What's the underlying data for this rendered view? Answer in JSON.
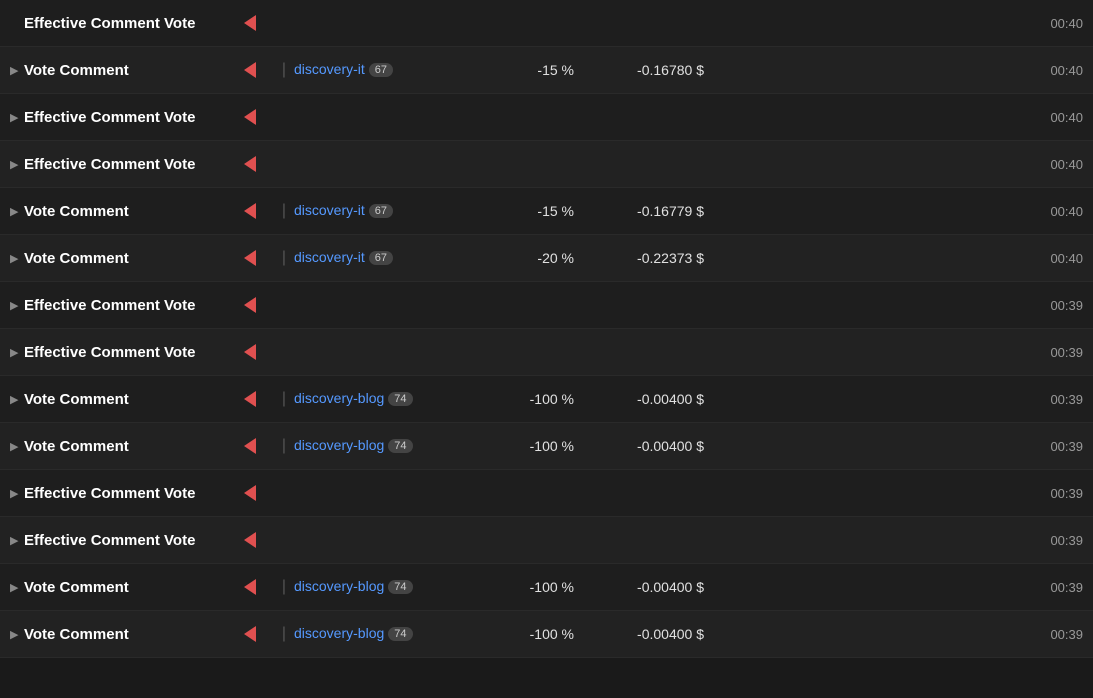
{
  "rows": [
    {
      "type": "effective",
      "title": "Effective Comment Vote",
      "hasExpand": false,
      "time": "00:40"
    },
    {
      "type": "vote",
      "title": "Vote Comment",
      "hasExpand": true,
      "tag": "discovery-it",
      "badge": "67",
      "percent": "-15 %",
      "value": "-0.16780 $",
      "time": "00:40"
    },
    {
      "type": "effective",
      "title": "Effective Comment Vote",
      "hasExpand": true,
      "time": "00:40"
    },
    {
      "type": "effective",
      "title": "Effective Comment Vote",
      "hasExpand": true,
      "time": "00:40"
    },
    {
      "type": "vote",
      "title": "Vote Comment",
      "hasExpand": true,
      "tag": "discovery-it",
      "badge": "67",
      "percent": "-15 %",
      "value": "-0.16779 $",
      "time": "00:40"
    },
    {
      "type": "vote",
      "title": "Vote Comment",
      "hasExpand": true,
      "tag": "discovery-it",
      "badge": "67",
      "percent": "-20 %",
      "value": "-0.22373 $",
      "time": "00:40"
    },
    {
      "type": "effective",
      "title": "Effective Comment Vote",
      "hasExpand": true,
      "time": "00:39"
    },
    {
      "type": "effective",
      "title": "Effective Comment Vote",
      "hasExpand": true,
      "time": "00:39"
    },
    {
      "type": "vote",
      "title": "Vote Comment",
      "hasExpand": true,
      "tag": "discovery-blog",
      "badge": "74",
      "percent": "-100 %",
      "value": "-0.00400 $",
      "time": "00:39"
    },
    {
      "type": "vote",
      "title": "Vote Comment",
      "hasExpand": true,
      "tag": "discovery-blog",
      "badge": "74",
      "percent": "-100 %",
      "value": "-0.00400 $",
      "time": "00:39"
    },
    {
      "type": "effective",
      "title": "Effective Comment Vote",
      "hasExpand": true,
      "time": "00:39"
    },
    {
      "type": "effective",
      "title": "Effective Comment Vote",
      "hasExpand": true,
      "time": "00:39"
    },
    {
      "type": "vote",
      "title": "Vote Comment",
      "hasExpand": true,
      "tag": "discovery-blog",
      "badge": "74",
      "percent": "-100 %",
      "value": "-0.00400 $",
      "time": "00:39"
    },
    {
      "type": "vote",
      "title": "Vote Comment",
      "hasExpand": true,
      "tag": "discovery-blog",
      "badge": "74",
      "percent": "-100 %",
      "value": "-0.00400 $",
      "time": "00:39"
    }
  ],
  "labels": {
    "effective_comment_vote": "Effective Comment Vote",
    "vote_comment": "Vote Comment"
  }
}
